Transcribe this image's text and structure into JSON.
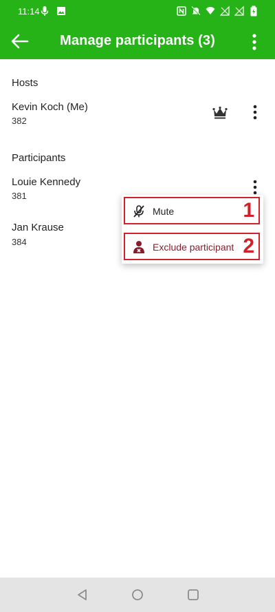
{
  "status_bar": {
    "time": "11:14",
    "icons_left": [
      "mic-icon",
      "image-icon"
    ],
    "icons_right": [
      "nfc-icon",
      "mute-bell-icon",
      "wifi-icon",
      "signal-icon",
      "signal-icon-2",
      "battery-icon"
    ]
  },
  "app_bar": {
    "title": "Manage participants (3)",
    "back_icon": "arrow-left-icon",
    "menu_icon": "more-vert-icon"
  },
  "hosts": {
    "label": "Hosts",
    "items": [
      {
        "name": "Kevin Koch (Me)",
        "id": "382",
        "badge_icon": "crown-icon"
      }
    ]
  },
  "participants": {
    "label": "Participants",
    "items": [
      {
        "name": "Louie Kennedy",
        "id": "381"
      },
      {
        "name": "Jan Krause",
        "id": "384"
      }
    ]
  },
  "context_menu": {
    "items": [
      {
        "label": "Mute",
        "icon": "mic-off-icon",
        "marker": "1"
      },
      {
        "label": "Exclude participant",
        "icon": "remove-user-icon",
        "marker": "2"
      }
    ]
  },
  "colors": {
    "primary": "#26b318",
    "highlight": "#d0202a",
    "exclude_text": "#8a1c2b",
    "nav_bg": "#e4e4e4"
  }
}
